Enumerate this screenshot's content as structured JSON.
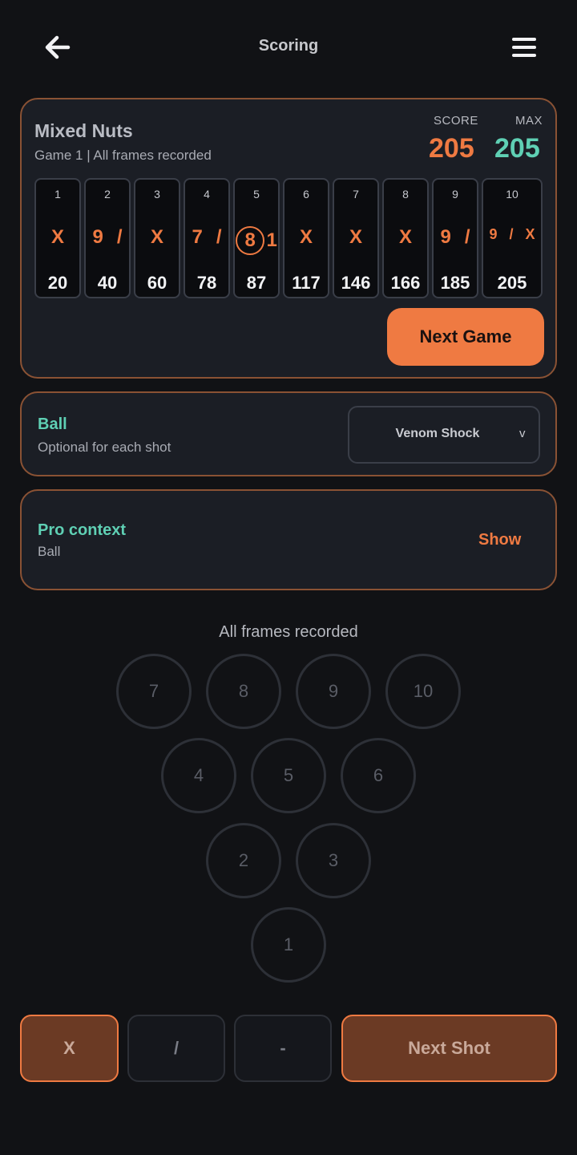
{
  "header": {
    "title": "Scoring",
    "back_icon": "arrow-left-icon",
    "menu_icon": "hamburger-menu-icon"
  },
  "score_card": {
    "team": "Mixed Nuts",
    "status": "Game 1 | All frames recorded",
    "score_label": "SCORE",
    "max_label": "MAX",
    "score": "205",
    "max": "205",
    "score_color": "#ef7a42",
    "max_color": "#5fd0b4",
    "frames": [
      {
        "num": "1",
        "r1": "X",
        "r2": "",
        "total": "20"
      },
      {
        "num": "2",
        "r1": "9",
        "r2": "/",
        "total": "40"
      },
      {
        "num": "3",
        "r1": "X",
        "r2": "",
        "total": "60"
      },
      {
        "num": "4",
        "r1": "7",
        "r2": "/",
        "total": "78"
      },
      {
        "num": "5",
        "r1": "8",
        "r2": "1",
        "total": "87"
      },
      {
        "num": "6",
        "r1": "X",
        "r2": "",
        "total": "117"
      },
      {
        "num": "7",
        "r1": "X",
        "r2": "",
        "total": "146"
      },
      {
        "num": "8",
        "r1": "X",
        "r2": "",
        "total": "166"
      },
      {
        "num": "9",
        "r1": "9",
        "r2": "/",
        "total": "185"
      },
      {
        "num": "10",
        "r1": "9",
        "r2": "/",
        "r3": "X",
        "total": "205"
      }
    ],
    "next_game_label": "Next Game"
  },
  "ball": {
    "title": "Ball",
    "subtitle": "Optional for each shot",
    "selected": "Venom Shock",
    "arrow": "v"
  },
  "pro": {
    "title": "Pro context",
    "subtitle": "Ball",
    "toggle_label": "Show"
  },
  "pins": {
    "status": "All frames recorded",
    "labels": [
      "7",
      "8",
      "9",
      "10",
      "4",
      "5",
      "6",
      "2",
      "3",
      "1"
    ]
  },
  "actions": {
    "strike": "X",
    "spare": "/",
    "miss": "-",
    "next_shot": "Next Shot"
  },
  "colors": {
    "accent": "#ef7a42",
    "teal": "#5fd0b4",
    "background": "#111215",
    "card": "#1b1e25"
  }
}
